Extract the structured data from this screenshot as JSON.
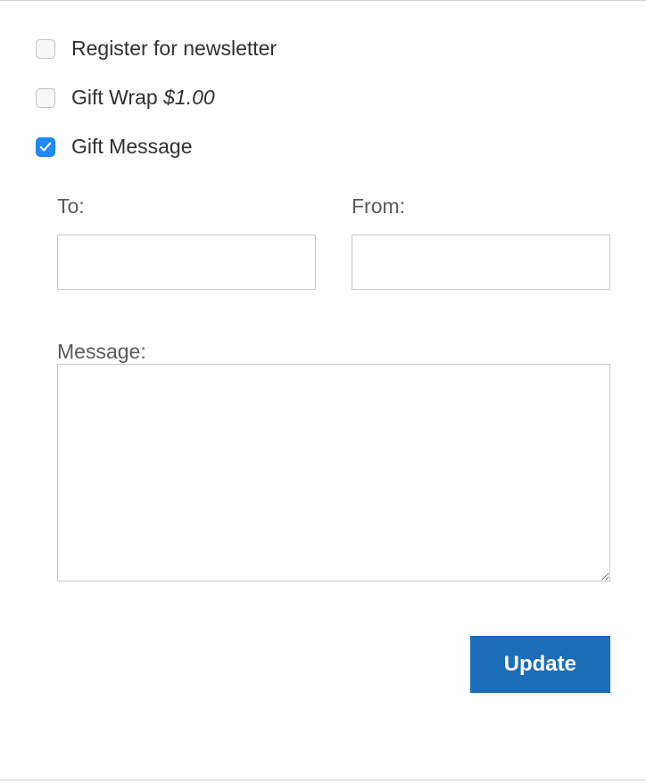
{
  "options": {
    "newsletter": {
      "label": "Register for newsletter",
      "checked": false
    },
    "giftWrap": {
      "label": "Gift Wrap",
      "price": "$1.00",
      "checked": false
    },
    "giftMessage": {
      "label": "Gift Message",
      "checked": true
    }
  },
  "giftMessageForm": {
    "to": {
      "label": "To:",
      "value": ""
    },
    "from": {
      "label": "From:",
      "value": ""
    },
    "message": {
      "label": "Message:",
      "value": ""
    }
  },
  "actions": {
    "updateLabel": "Update"
  },
  "colors": {
    "accent": "#1e88f5",
    "buttonPrimary": "#1b6db8"
  }
}
